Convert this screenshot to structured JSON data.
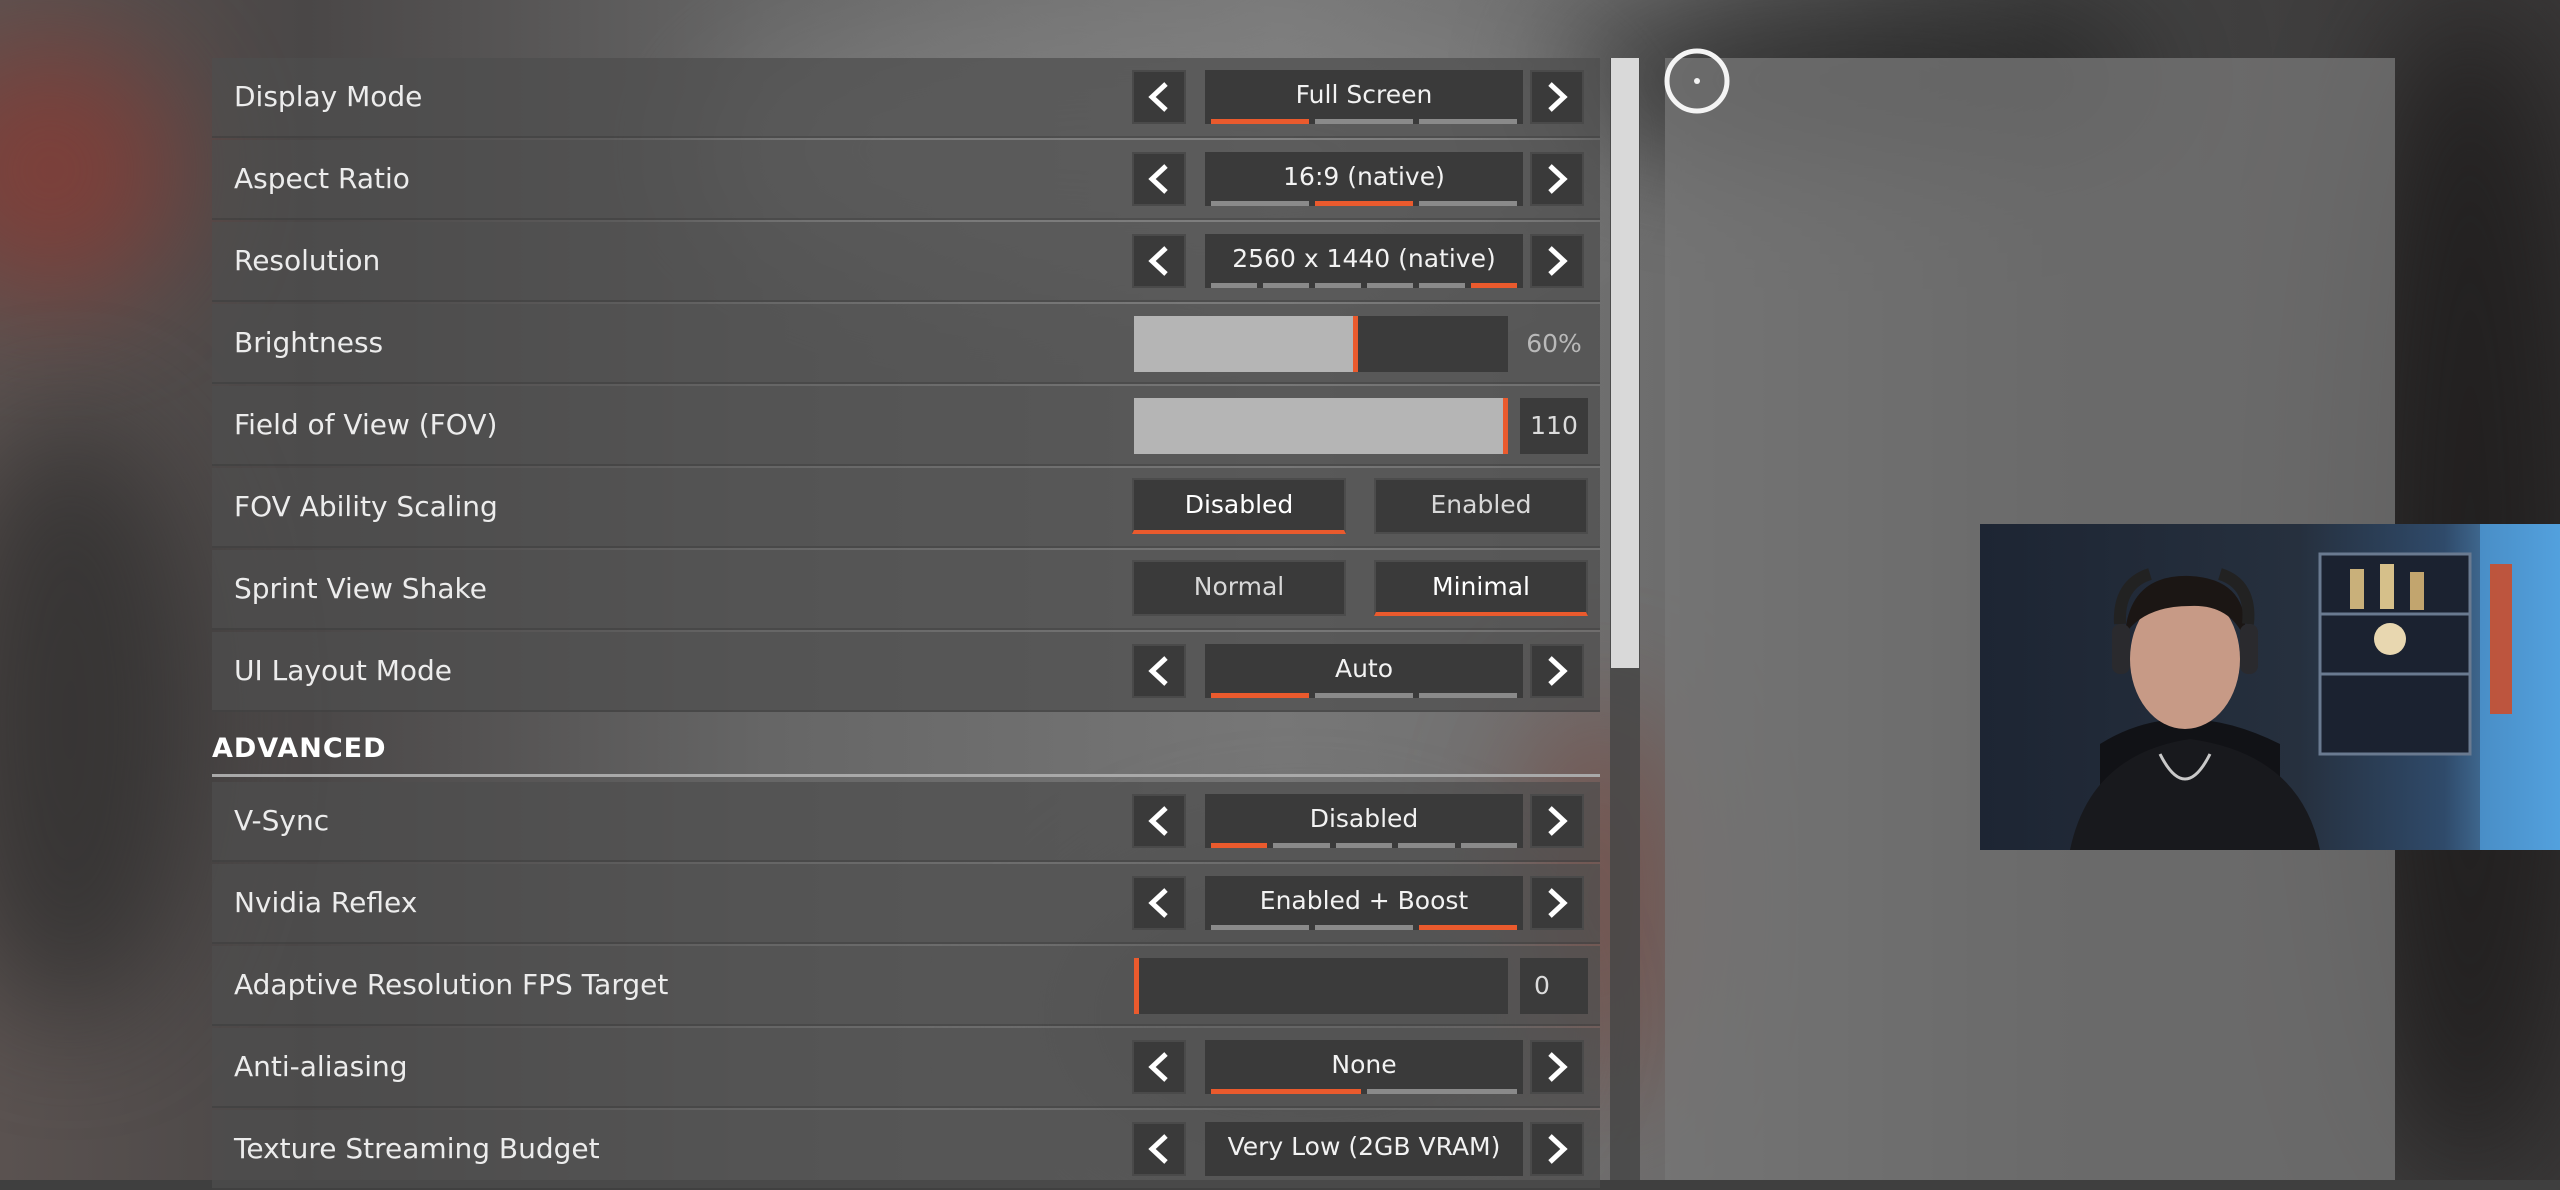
{
  "settings": {
    "display_mode": {
      "label": "Display Mode",
      "value": "Full Screen",
      "options_count": 3,
      "selected_index": 0
    },
    "aspect_ratio": {
      "label": "Aspect Ratio",
      "value": "16:9 (native)",
      "options_count": 3,
      "selected_index": 1
    },
    "resolution": {
      "label": "Resolution",
      "value": "2560 x 1440 (native)",
      "options_count": 6,
      "selected_index": 5
    },
    "brightness": {
      "label": "Brightness",
      "value": "60%",
      "level": 0.6
    },
    "fov": {
      "label": "Field of View (FOV)",
      "value": "110",
      "level": 1.0
    },
    "fov_scaling": {
      "label": "FOV Ability Scaling",
      "option_a": "Disabled",
      "option_b": "Enabled",
      "selected": "Disabled"
    },
    "sprint_shake": {
      "label": "Sprint View Shake",
      "option_a": "Normal",
      "option_b": "Minimal",
      "selected": "Minimal"
    },
    "ui_layout": {
      "label": "UI Layout Mode",
      "value": "Auto",
      "options_count": 3,
      "selected_index": 0
    }
  },
  "advanced": {
    "heading": "ADVANCED",
    "vsync": {
      "label": "V-Sync",
      "value": "Disabled",
      "options_count": 5,
      "selected_index": 0
    },
    "reflex": {
      "label": "Nvidia Reflex",
      "value": "Enabled + Boost",
      "options_count": 3,
      "selected_index": 2
    },
    "adaptive_fps": {
      "label": "Adaptive Resolution FPS Target",
      "value": "0",
      "level": 0.0
    },
    "antialiasing": {
      "label": "Anti-aliasing",
      "value": "None",
      "options_count": 2,
      "selected_index": 0
    },
    "texture_budget": {
      "label": "Texture Streaming Budget",
      "value": "Very Low (2GB VRAM)"
    }
  },
  "colors": {
    "accent": "#ea5a2d",
    "row_bg": "#4e4e4e",
    "button_bg": "#3a3a3a"
  },
  "icons": [
    "chevron-left-icon",
    "chevron-right-icon",
    "crosshair-icon"
  ]
}
